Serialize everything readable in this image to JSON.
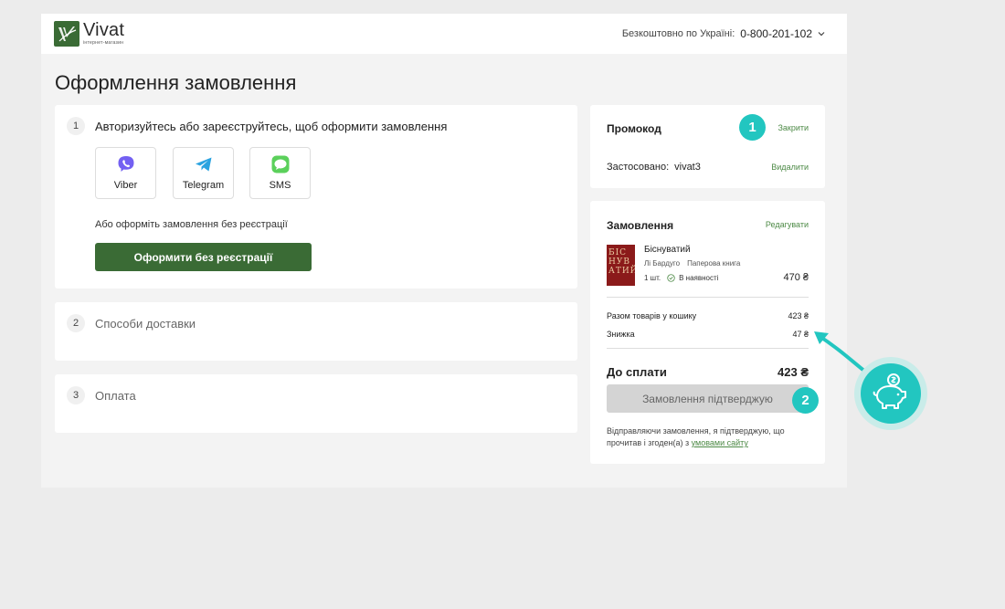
{
  "header": {
    "logo_name": "Vivat",
    "logo_sub": "інтернет-магазин",
    "phone_label": "Безкоштовно по Україні:",
    "phone_number": "0-800-201-102"
  },
  "page_title": "Оформлення замовлення",
  "step1": {
    "number": "1",
    "title": "Авторизуйтесь або зареєструйтесь, щоб оформити замовлення",
    "messengers": [
      {
        "label": "Viber",
        "icon": "viber-icon",
        "color": "#7360f2"
      },
      {
        "label": "Telegram",
        "icon": "telegram-icon",
        "color": "#2aa3e0"
      },
      {
        "label": "SMS",
        "icon": "sms-icon",
        "color": "#5bd05b"
      }
    ],
    "alt_text": "Або оформіть замовлення без реєстрації",
    "button_label": "Оформити без реєстрації"
  },
  "step2": {
    "number": "2",
    "title": "Способи доставки"
  },
  "step3": {
    "number": "3",
    "title": "Оплата"
  },
  "promo": {
    "title": "Промокод",
    "close_link": "Закрити",
    "applied_label": "Застосовано:",
    "applied_code": "vivat3",
    "delete_link": "Видалити"
  },
  "order": {
    "title": "Замовлення",
    "edit_link": "Редагувати",
    "item": {
      "title": "Біснуватий",
      "author": "Лі Бардуго",
      "format": "Паперова книга",
      "qty": "1 шт.",
      "availability": "В наявності",
      "price": "470 ₴",
      "cover_text": "БІС НУВ АТИЙ"
    },
    "subtotal_label": "Разом товарів у кошику",
    "subtotal_value": "423 ₴",
    "discount_label": "Знижка",
    "discount_value": "47 ₴",
    "total_label": "До сплати",
    "total_value": "423 ₴",
    "confirm_button": "Замовлення підтверджую",
    "legal_text": "Відправляючи замовлення, я підтверджую, що прочитав і згоден(а) з",
    "legal_link": "умовами сайту"
  },
  "annotations": {
    "marker_1": "1",
    "marker_2": "2",
    "accent_color": "#22c6c0"
  },
  "colors": {
    "brand_green": "#3a6b35",
    "link_green": "#4d8a46"
  }
}
